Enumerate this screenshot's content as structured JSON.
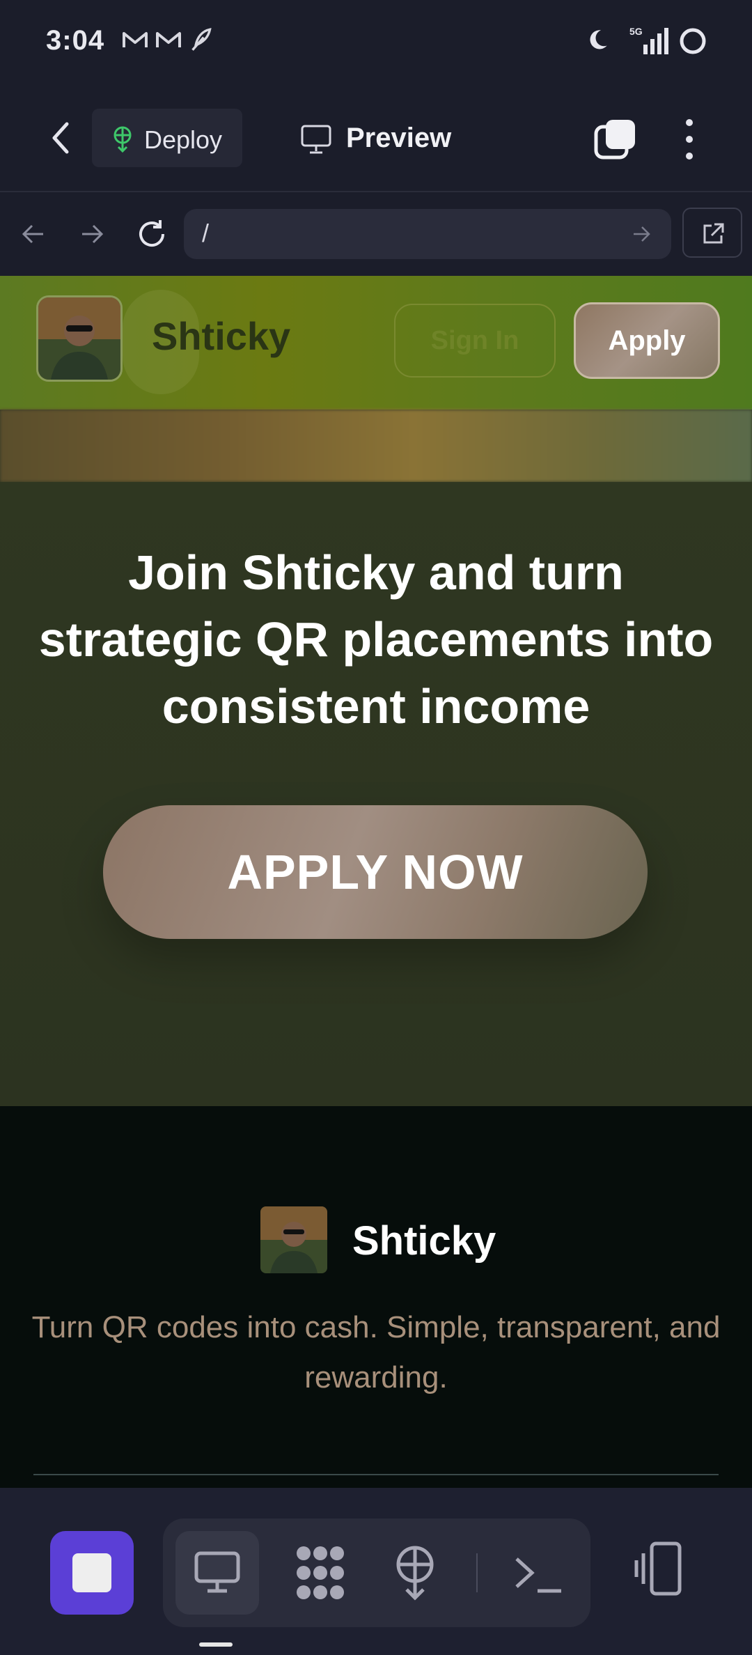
{
  "status_bar": {
    "time": "3:04",
    "icons": [
      "gmail-icon",
      "gmail-icon",
      "feather-icon",
      "moon-icon",
      "signal-5g-icon",
      "circle-icon"
    ],
    "network_label": "5G"
  },
  "toolbar": {
    "back_icon": "chevron-left-icon",
    "deploy_label": "Deploy",
    "preview_label": "Preview",
    "tabs_icon": "tabs-icon",
    "menu_icon": "more-vert-icon"
  },
  "url_bar": {
    "url": "/",
    "back_icon": "arrow-left-icon",
    "forward_icon": "arrow-right-icon",
    "reload_icon": "reload-icon",
    "go_icon": "arrow-right-icon",
    "external_icon": "open-external-icon"
  },
  "site": {
    "brand": "Shticky",
    "signin_label": "Sign In",
    "apply_label": "Apply",
    "hero_title": "Join Shticky and turn strategic QR placements into consistent income",
    "cta_label": "APPLY NOW",
    "footer_brand": "Shticky",
    "footer_tagline": "Turn QR codes into cash. Simple, transparent, and rewarding."
  },
  "bottom_nav": {
    "items": [
      "home-icon",
      "desktop-icon",
      "apps-icon",
      "deploy-icon",
      "terminal-icon",
      "devices-icon"
    ]
  },
  "colors": {
    "accent": "#5b3fd6",
    "header_green": "#6b7a12",
    "tagline": "#a8907b"
  }
}
